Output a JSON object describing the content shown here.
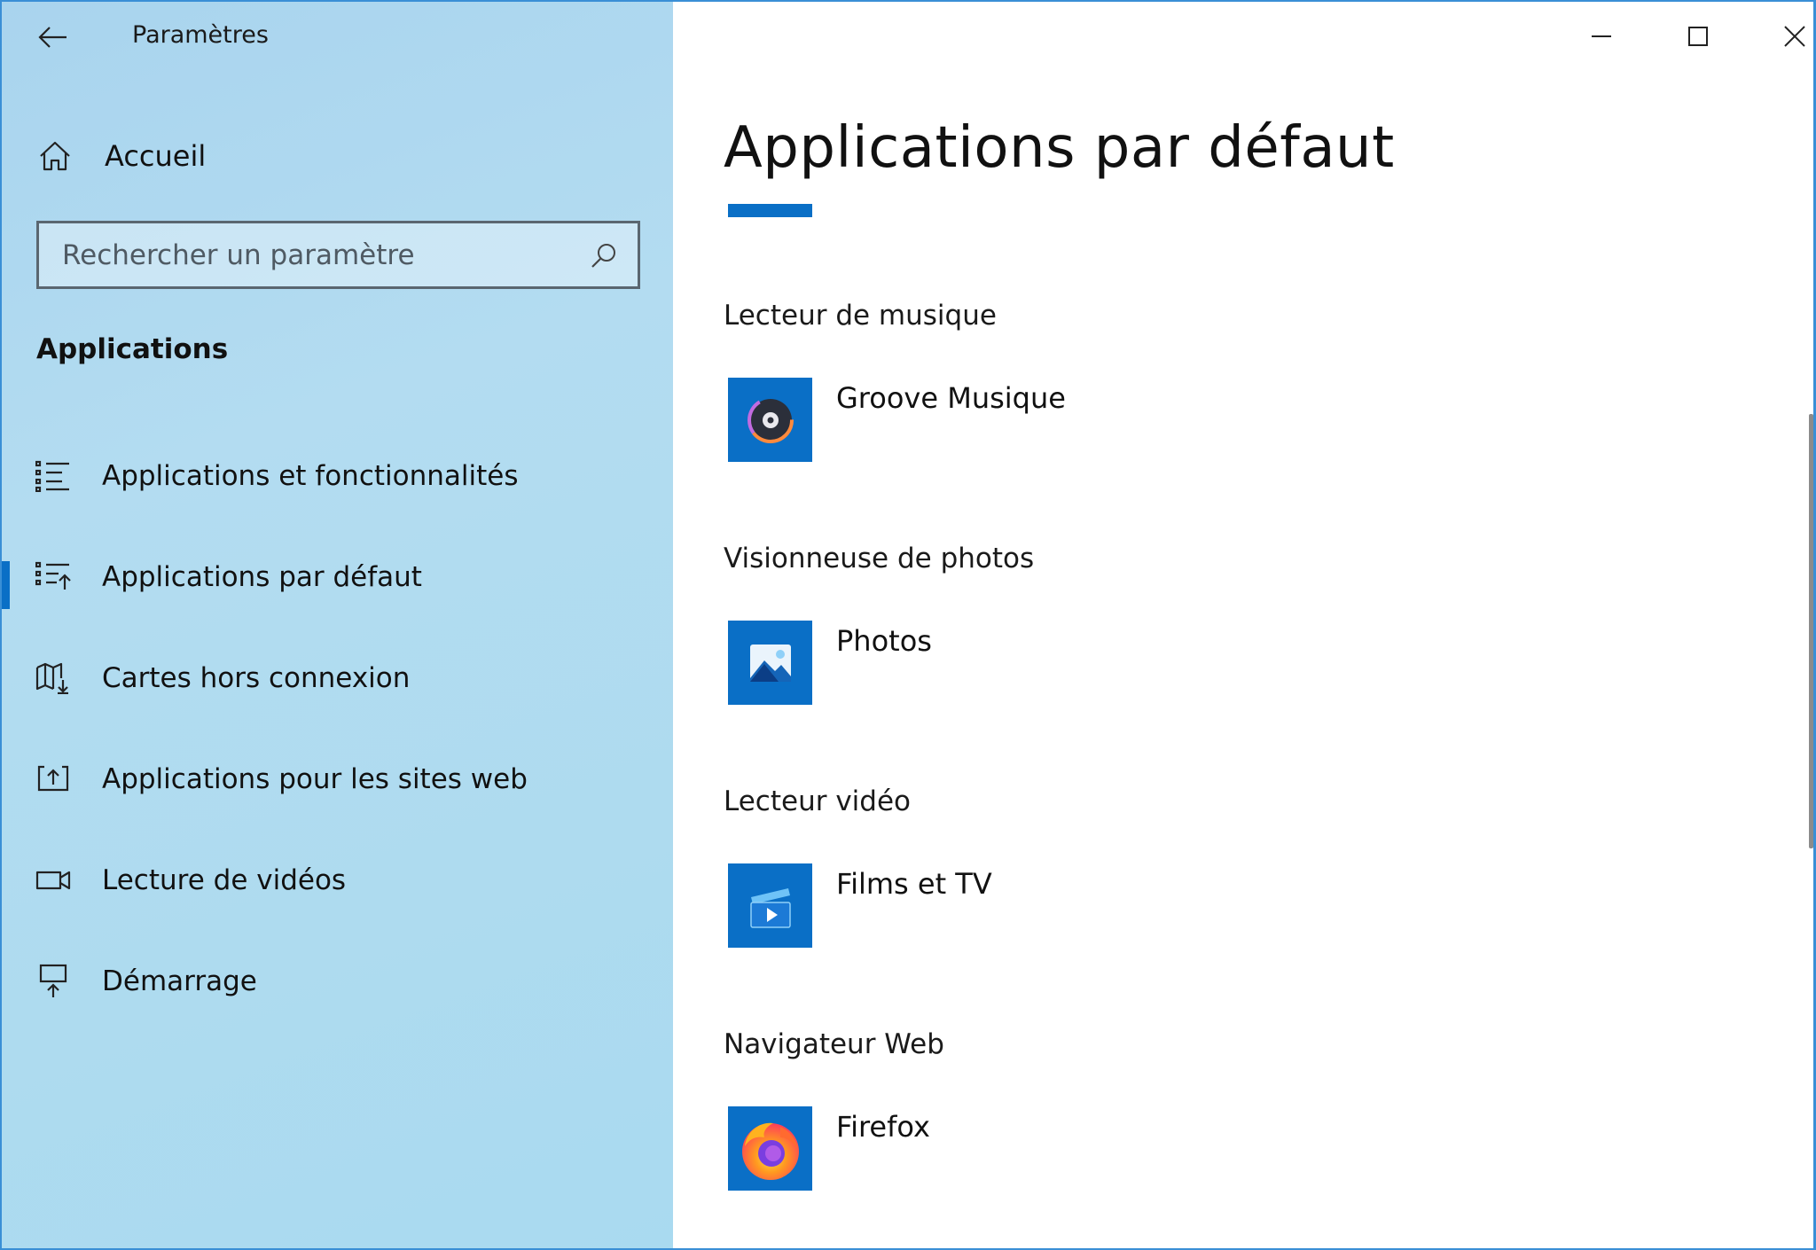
{
  "window": {
    "title": "Paramètres",
    "controls": [
      "minimize",
      "maximize",
      "close"
    ],
    "accent_color": "#0a6fc6"
  },
  "sidebar": {
    "home_label": "Accueil",
    "search_placeholder": "Rechercher un paramètre",
    "section_title": "Applications",
    "items": [
      {
        "label": "Applications et fonctionnalités",
        "icon": "list-icon",
        "selected": false
      },
      {
        "label": "Applications par défaut",
        "icon": "default-apps-icon",
        "selected": true
      },
      {
        "label": "Cartes hors connexion",
        "icon": "map-download-icon",
        "selected": false
      },
      {
        "label": "Applications pour les sites web",
        "icon": "website-app-icon",
        "selected": false
      },
      {
        "label": "Lecture de vidéos",
        "icon": "video-icon",
        "selected": false
      },
      {
        "label": "Démarrage",
        "icon": "startup-icon",
        "selected": false
      }
    ]
  },
  "main": {
    "page_title": "Applications par défaut",
    "defaults": [
      {
        "category": "Lecteur de musique",
        "app": "Groove Musique",
        "icon": "groove-icon"
      },
      {
        "category": "Visionneuse de photos",
        "app": "Photos",
        "icon": "photos-icon"
      },
      {
        "category": "Lecteur vidéo",
        "app": "Films et TV",
        "icon": "films-tv-icon"
      },
      {
        "category": "Navigateur Web",
        "app": "Firefox",
        "icon": "firefox-icon"
      }
    ]
  }
}
